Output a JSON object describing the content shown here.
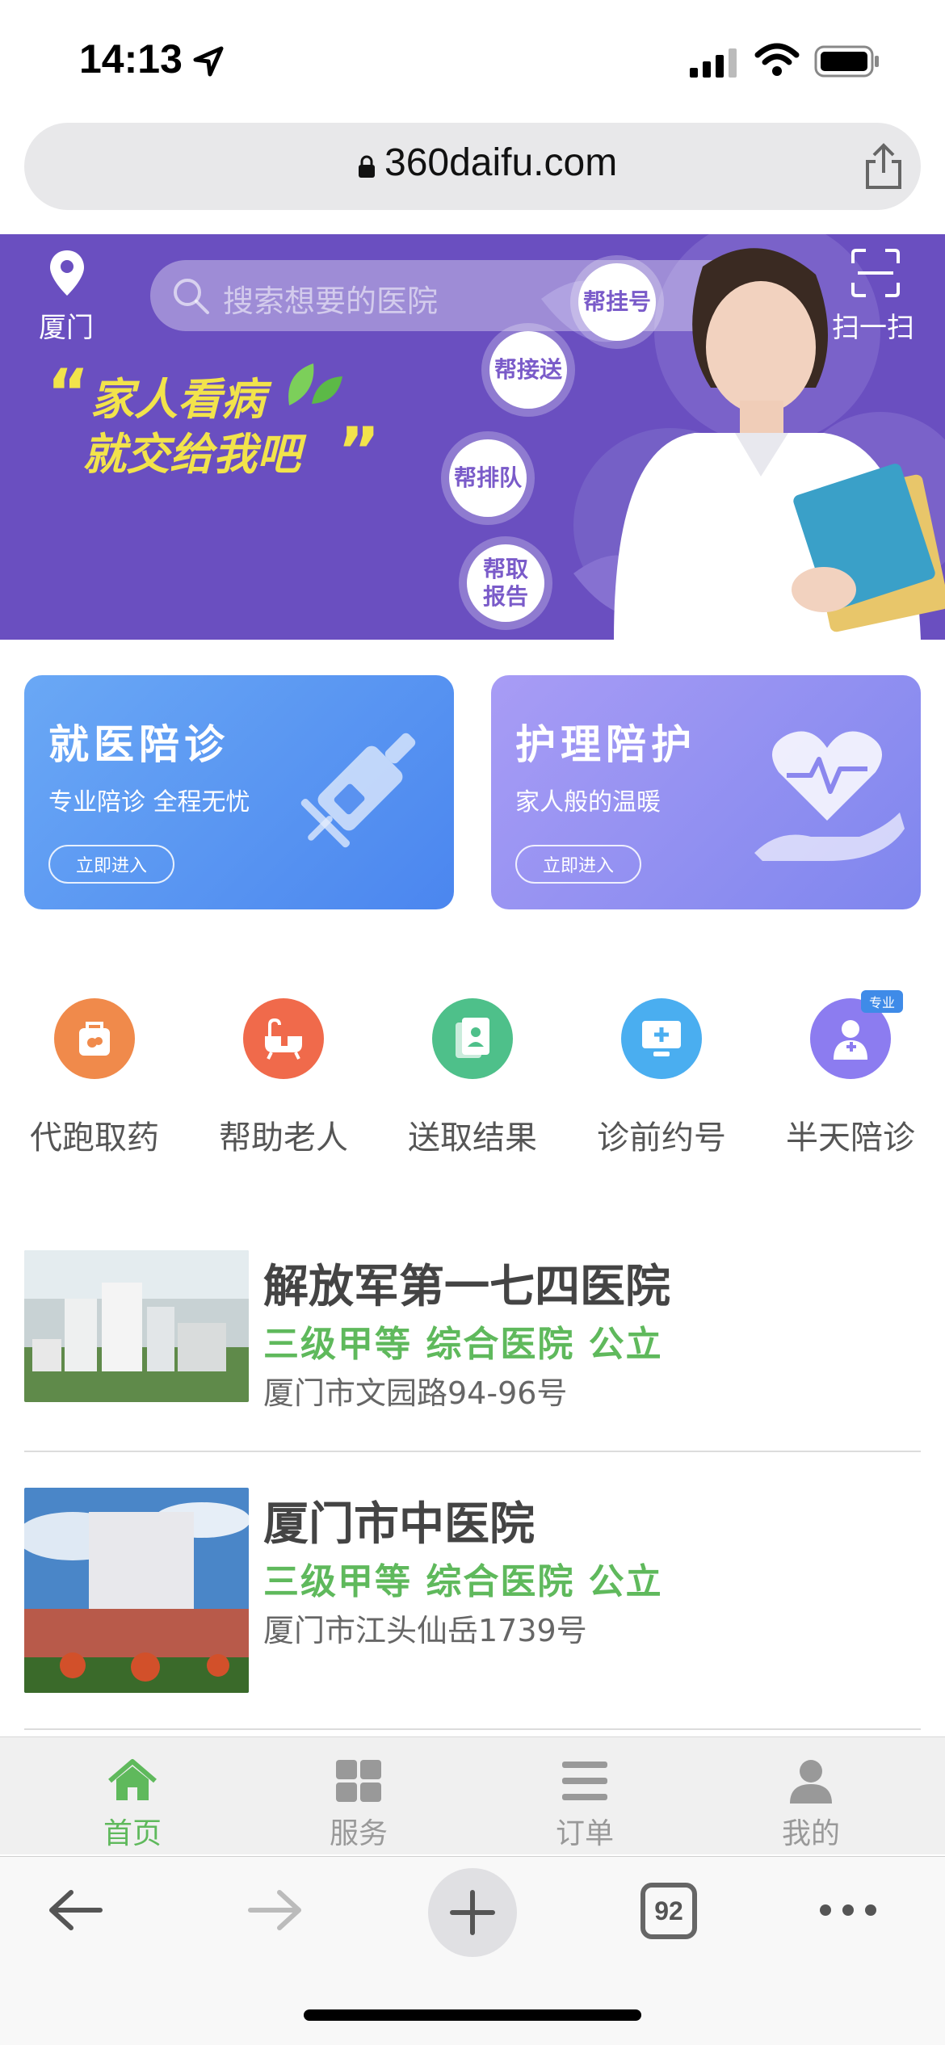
{
  "status_bar": {
    "time": "14:13"
  },
  "browser": {
    "url": "360daifu.com",
    "tabs_count": "92"
  },
  "banner": {
    "city": "厦门",
    "search_placeholder": "搜索想要的医院",
    "scan_label": "扫一扫",
    "slogan_line1": "家人看病",
    "slogan_line2": "就交给我吧",
    "bubbles": [
      "帮挂号",
      "帮接送",
      "帮排队",
      "帮取\n报告"
    ],
    "colors": {
      "background": "#6a4fc0",
      "slogan": "#f2e34b"
    }
  },
  "cards": [
    {
      "title": "就医陪诊",
      "subtitle": "专业陪诊 全程无忧",
      "button": "立即进入",
      "icon": "syringe-icon"
    },
    {
      "title": "护理陪护",
      "subtitle": "家人般的温暖",
      "button": "立即进入",
      "icon": "heart-hand-icon"
    }
  ],
  "quick_menu": {
    "items": [
      {
        "label": "代跑取药",
        "icon": "medicine-bag-icon",
        "color": "#f08a4b"
      },
      {
        "label": "帮助老人",
        "icon": "bathtub-icon",
        "color": "#f06a4b"
      },
      {
        "label": "送取结果",
        "icon": "document-icon",
        "color": "#4ec08a"
      },
      {
        "label": "诊前约号",
        "icon": "monitor-icon",
        "color": "#4aaef0"
      },
      {
        "label": "半天陪诊",
        "icon": "nurse-icon",
        "color": "#8c7cf0"
      }
    ],
    "badge": "专业"
  },
  "hospitals": [
    {
      "name": "解放军第一七四医院",
      "tags": "三级甲等 综合医院 公立",
      "address": "厦门市文园路94-96号"
    },
    {
      "name": "厦门市中医院",
      "tags": "三级甲等 综合医院 公立",
      "address": "厦门市江头仙岳1739号"
    }
  ],
  "tabbar": {
    "items": [
      {
        "label": "首页",
        "icon": "home-icon",
        "active": true
      },
      {
        "label": "服务",
        "icon": "grid-icon",
        "active": false
      },
      {
        "label": "订单",
        "icon": "list-icon",
        "active": false
      },
      {
        "label": "我的",
        "icon": "user-icon",
        "active": false
      }
    ],
    "active_color": "#5fb95c"
  }
}
